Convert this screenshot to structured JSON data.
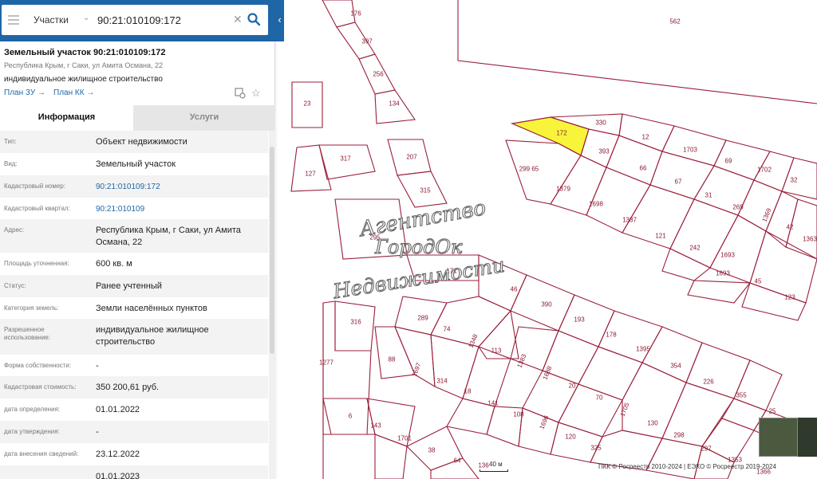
{
  "search": {
    "type_label": "Участки",
    "value": "90:21:010109:172",
    "clear_glyph": "✕",
    "collapse_glyph": "‹"
  },
  "object": {
    "title": "Земельный участок 90:21:010109:172",
    "address": "Республика Крым, г Саки, ул Амита Османа, 22",
    "purpose": "индивидуальное жилищное строительство",
    "plan_zu": "План ЗУ →",
    "plan_kk": "План КК →"
  },
  "tabs": {
    "info": "Информация",
    "services": "Услуги"
  },
  "properties": [
    {
      "label": "Тип:",
      "value": "Объект недвижимости"
    },
    {
      "label": "Вид:",
      "value": "Земельный участок"
    },
    {
      "label": "Кадастровый номер:",
      "value": "90:21:010109:172"
    },
    {
      "label": "Кадастровый квартал:",
      "value": "90:21:010109"
    },
    {
      "label": "Адрес:",
      "value": "Республика Крым, г Саки, ул Амита Османа, 22"
    },
    {
      "label": "Площадь уточненная:",
      "value": "600 кв. м"
    },
    {
      "label": "Статус:",
      "value": "Ранее учтенный"
    },
    {
      "label": "Категория земель:",
      "value": "Земли населённых пунктов"
    },
    {
      "label": "Разрешенное использование:",
      "value": "индивидуальное жилищное строительство"
    },
    {
      "label": "Форма собственности:",
      "value": "-"
    },
    {
      "label": "Кадастровая стоимость:",
      "value": "350 200,61 руб."
    },
    {
      "label": "дата определения:",
      "value": "01.01.2022"
    },
    {
      "label": "дата утверждения:",
      "value": "-"
    },
    {
      "label": "дата внесения сведений:",
      "value": "23.12.2022"
    },
    {
      "label": "",
      "value": "01.01.2023"
    }
  ],
  "map": {
    "highlight_color": "#f7f43a",
    "parcel_color": "#9a1f3a",
    "labels": [
      "176",
      "562",
      "397",
      "256",
      "134",
      "23",
      "330",
      "172",
      "12",
      "1703",
      "393",
      "69",
      "1702",
      "66",
      "32",
      "299 65",
      "67",
      "1379",
      "31",
      "1698",
      "269",
      "1369",
      "42",
      "1337",
      "207",
      "315",
      "121",
      "1693",
      "242",
      "1693",
      "45",
      "123",
      "317",
      "127",
      "295",
      "171",
      "46",
      "390",
      "289",
      "74",
      "316",
      "1348",
      "193",
      "178",
      "1277",
      "88",
      "113",
      "1383",
      "1688",
      "1395",
      "354",
      "1697",
      "314",
      "18",
      "20",
      "226",
      "355",
      "141",
      "108",
      "70",
      "1705",
      "25",
      "6",
      "143",
      "1696",
      "120",
      "130",
      "298",
      "1701",
      "38",
      "64",
      "136",
      "325",
      "297",
      "1353",
      "1366",
      "1363"
    ]
  },
  "watermark": {
    "line1": "Агентство",
    "line2": "ГородОк",
    "line3": "Недвижимости"
  },
  "footer": {
    "scale": "40 м",
    "copyright": "ПКК © Росреестр 2010-2024 | ЕЭКО © Росреестр 2019-2024"
  }
}
